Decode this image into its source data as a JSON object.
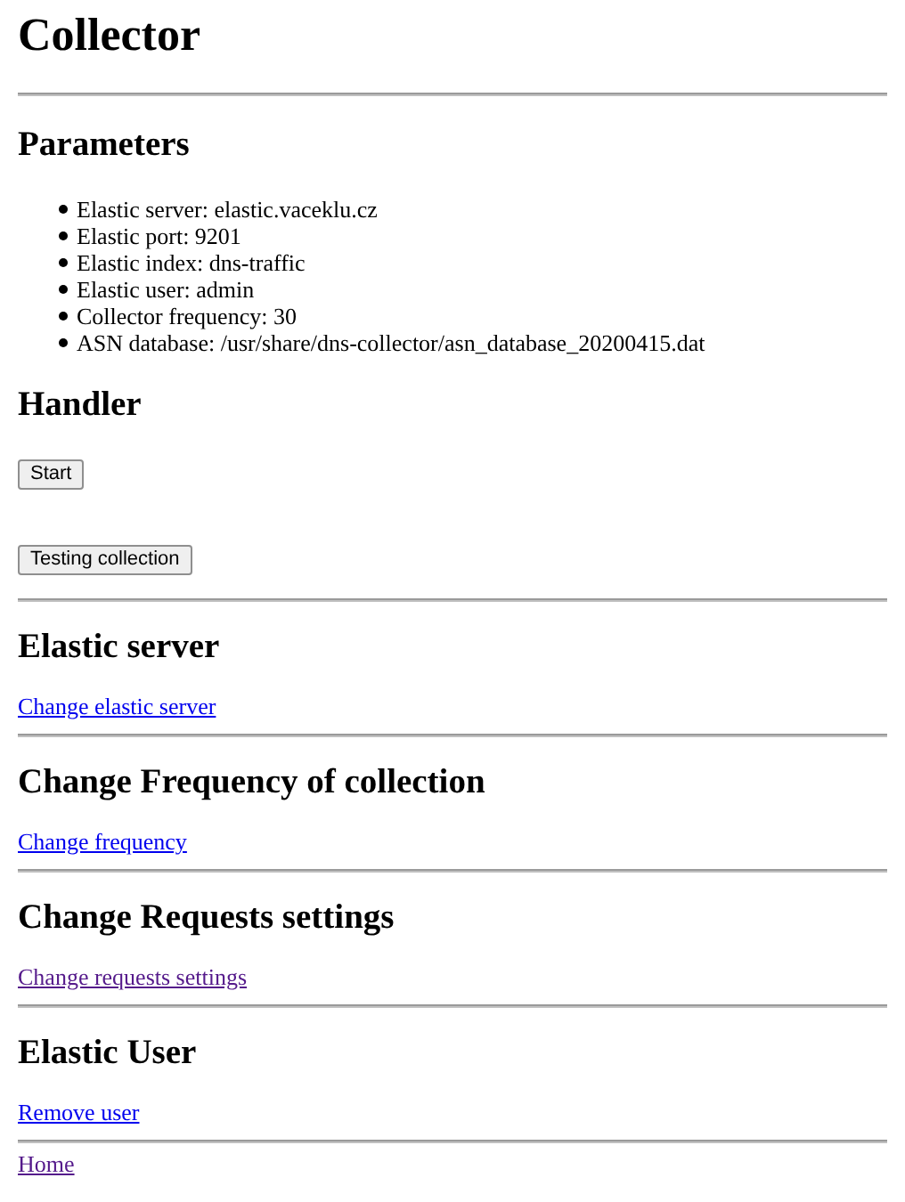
{
  "title": "Collector",
  "sections": [
    {
      "kind": "list",
      "heading": "Parameters",
      "items": [
        "Elastic server: elastic.vaceklu.cz",
        "Elastic port: 9201",
        "Elastic index: dns-traffic",
        "Elastic user: admin",
        "Collector frequency: 30",
        "ASN database: /usr/share/dns-collector/asn_database_20200415.dat"
      ]
    },
    {
      "kind": "buttons",
      "heading": "Handler",
      "buttons": [
        "Start",
        "Testing collection"
      ]
    },
    {
      "kind": "link",
      "heading": "Elastic server",
      "link": {
        "label": "Change elastic server",
        "visited": false
      }
    },
    {
      "kind": "link",
      "heading": "Change Frequency of collection",
      "link": {
        "label": "Change frequency",
        "visited": false
      }
    },
    {
      "kind": "link",
      "heading": "Change Requests settings",
      "link": {
        "label": "Change requests settings",
        "visited": true
      }
    },
    {
      "kind": "link",
      "heading": "Elastic User",
      "link": {
        "label": "Remove user",
        "visited": false
      }
    }
  ],
  "footer_link": {
    "label": "Home",
    "visited": true
  }
}
